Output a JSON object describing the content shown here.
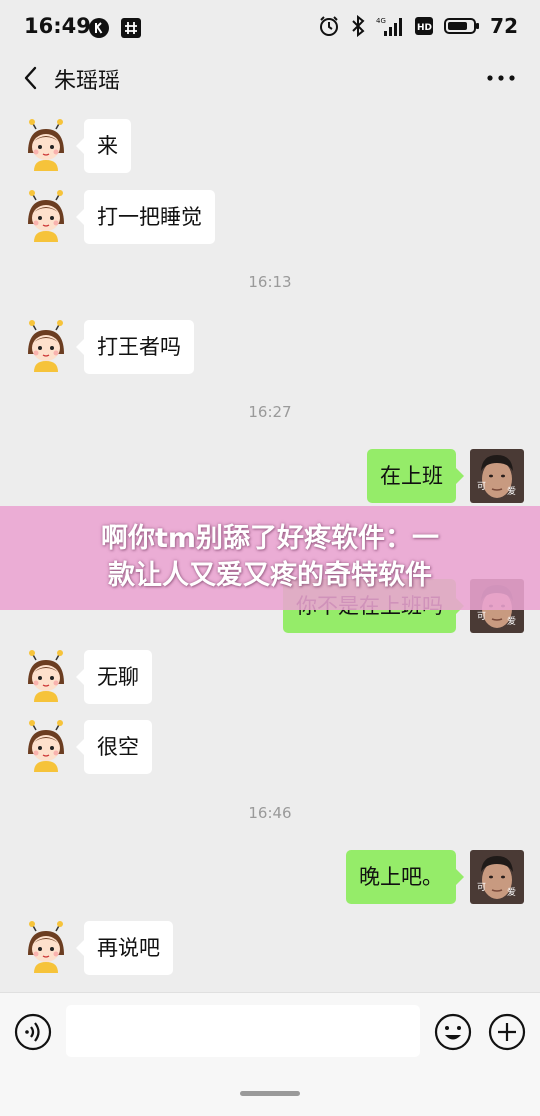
{
  "status_bar": {
    "time": "16:49",
    "battery": "72"
  },
  "header": {
    "title": "朱瑶瑶"
  },
  "messages": [
    {
      "from": "contact",
      "text": "来"
    },
    {
      "from": "contact",
      "text": "打一把睡觉"
    },
    {
      "type": "time",
      "text": "16:13"
    },
    {
      "from": "contact",
      "text": "打王者吗"
    },
    {
      "type": "time",
      "text": "16:27"
    },
    {
      "from": "me",
      "text": "在上班"
    },
    {
      "from": "me",
      "text": "你不是在上班吗"
    },
    {
      "from": "contact",
      "text": "无聊"
    },
    {
      "from": "contact",
      "text": "很空"
    },
    {
      "type": "time",
      "text": "16:46"
    },
    {
      "from": "me",
      "text": "晚上吧。"
    },
    {
      "from": "contact",
      "text": "再说吧"
    }
  ],
  "banner": {
    "line1": "啊你tm别舔了好疼软件：一",
    "line2": "款让人又爱又疼的奇特软件"
  },
  "avatar_me_caption": [
    "可",
    "爱"
  ],
  "input": {
    "value": "",
    "placeholder": ""
  },
  "colors": {
    "background": "#ededed",
    "my_bubble": "#95ec69",
    "contact_bubble": "#ffffff",
    "banner": "#eaa4d2"
  }
}
